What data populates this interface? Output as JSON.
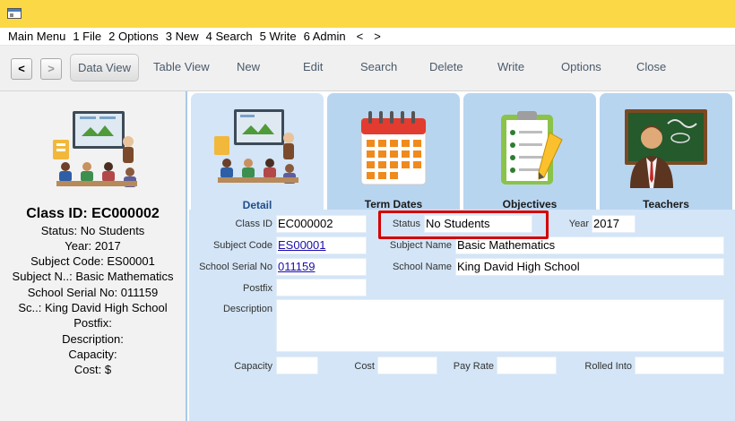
{
  "menu": {
    "items": [
      "Main Menu",
      "1 File",
      "2 Options",
      "3 New",
      "4 Search",
      "5 Write",
      "6 Admin"
    ],
    "prev_arrow": "<",
    "next_arrow": ">"
  },
  "toolbar": {
    "back_label": "<",
    "forward_label": ">",
    "data_view": "Data View",
    "table_view": "Table View",
    "new": "New",
    "edit": "Edit",
    "search": "Search",
    "delete": "Delete",
    "write": "Write",
    "options": "Options",
    "close": "Close"
  },
  "summary": {
    "title": "Class ID: EC000002",
    "status": "Status: No Students",
    "year": "Year: 2017",
    "subject_code": "Subject Code: ES00001",
    "subject_name": "Subject N..: Basic Mathematics",
    "school_serial": "School Serial No: 011159",
    "school_name": "Sc..: King David High School",
    "postfix": "Postfix:",
    "description": "Description:",
    "capacity": "Capacity:",
    "cost": "Cost: $"
  },
  "tabs": [
    {
      "label": "Detail",
      "icon": "classroom-icon"
    },
    {
      "label": "Term Dates",
      "icon": "calendar-icon"
    },
    {
      "label": "Objectives",
      "icon": "checklist-icon"
    },
    {
      "label": "Teachers",
      "icon": "teacher-icon"
    }
  ],
  "form": {
    "class_id_label": "Class ID",
    "class_id": "EC000002",
    "status_label": "Status",
    "status": "No Students",
    "year_label": "Year",
    "year": "2017",
    "subject_code_label": "Subject Code",
    "subject_code": "ES00001",
    "subject_name_label": "Subject Name",
    "subject_name": "Basic Mathematics",
    "school_serial_label": "School Serial No",
    "school_serial": "011159",
    "school_name_label": "School Name",
    "school_name": "King David High School",
    "postfix_label": "Postfix",
    "postfix": "",
    "description_label": "Description",
    "description": "",
    "capacity_label": "Capacity",
    "capacity": "",
    "cost_label": "Cost",
    "cost": "",
    "pay_rate_label": "Pay Rate",
    "pay_rate": "",
    "rolled_into_label": "Rolled Into",
    "rolled_into": ""
  },
  "colors": {
    "title_bar": "#fbd946",
    "panel_blue": "#d3e5f6",
    "tab_blue": "#b8d5f0",
    "highlight": "#d40000",
    "link": "#1a0dab"
  }
}
